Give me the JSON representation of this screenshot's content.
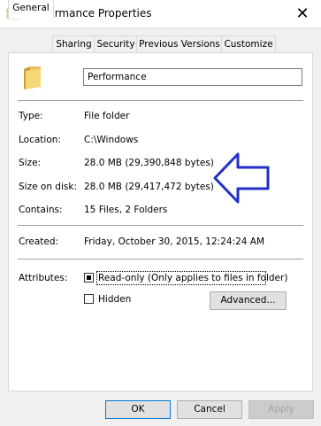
{
  "window": {
    "title": "Performance Properties",
    "close_glyph": "✕"
  },
  "tabs": [
    {
      "label": "General",
      "active": true
    },
    {
      "label": "Sharing",
      "active": false
    },
    {
      "label": "Security",
      "active": false
    },
    {
      "label": "Previous Versions",
      "active": false
    },
    {
      "label": "Customize",
      "active": false
    }
  ],
  "general": {
    "name_value": "Performance",
    "type_label": "Type:",
    "type_value": "File folder",
    "location_label": "Location:",
    "location_value": "C:\\Windows",
    "size_label": "Size:",
    "size_value": "28.0 MB (29,390,848 bytes)",
    "size_on_disk_label": "Size on disk:",
    "size_on_disk_value": "28.0 MB (29,417,472 bytes)",
    "contains_label": "Contains:",
    "contains_value": "15 Files, 2 Folders",
    "created_label": "Created:",
    "created_value": "Friday, October 30, 2015, 12:24:24 AM",
    "attributes_label": "Attributes:",
    "readonly_label": "Read-only (Only applies to files in folder)",
    "readonly_checked": true,
    "hidden_label": "Hidden",
    "hidden_checked": false,
    "advanced_label": "Advanced..."
  },
  "buttons": {
    "ok": "OK",
    "cancel": "Cancel",
    "apply": "Apply"
  },
  "colors": {
    "folder": "#e8c15a",
    "arrow": "#2530c8",
    "accent": "#0078d7"
  }
}
